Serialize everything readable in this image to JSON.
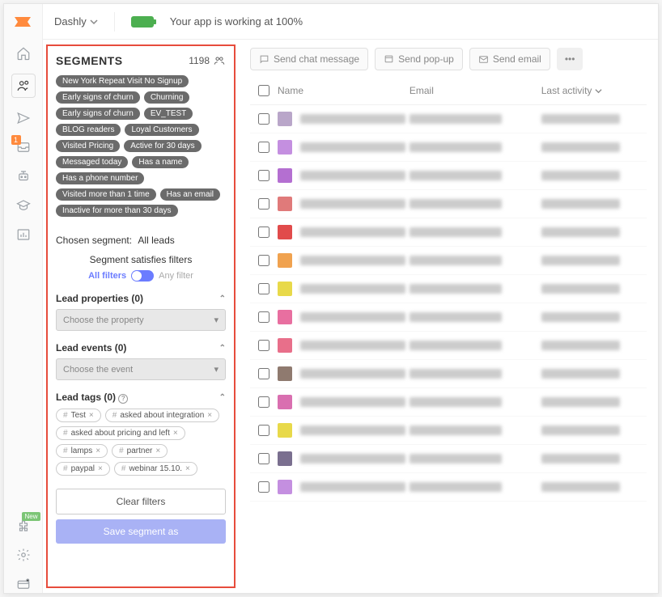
{
  "topbar": {
    "app_dropdown": "Dashly",
    "status_text": "Your app is working at 100%"
  },
  "rail": {
    "inbox_badge": "1",
    "plugin_badge": "New"
  },
  "panel": {
    "title": "SEGMENTS",
    "count": "1198",
    "chips": [
      "New York Repeat Visit No Signup",
      "Early signs of churn",
      "Churning",
      "Early signs of churn",
      "EV_TEST",
      "BLOG readers",
      "Loyal Customers",
      "Visited Pricing",
      "Active for 30 days",
      "Messaged today",
      "Has a name",
      "Has a phone number",
      "Visited more than 1 time",
      "Has an email",
      "Inactive for more than 30 days"
    ],
    "chosen_label": "Chosen segment:",
    "chosen_value": "All leads",
    "satisfies": "Segment satisfies filters",
    "toggle_left": "All filters",
    "toggle_right": "Any filter",
    "props_title": "Lead properties (0)",
    "props_placeholder": "Choose the property",
    "events_title": "Lead events (0)",
    "events_placeholder": "Choose the event",
    "tags_title": "Lead tags (0)",
    "tags": [
      "Test",
      "asked about integration",
      "asked about pricing and left",
      "lamps",
      "partner",
      "paypal",
      "webinar 15.10."
    ],
    "clear_btn": "Clear filters",
    "save_btn": "Save segment as"
  },
  "actions": {
    "chat": "Send chat message",
    "popup": "Send pop-up",
    "email": "Send email"
  },
  "table": {
    "col_name": "Name",
    "col_email": "Email",
    "col_activity": "Last activity",
    "rows": [
      {
        "color": "#b9a6c9"
      },
      {
        "color": "#c48fe0"
      },
      {
        "color": "#b46fd1"
      },
      {
        "color": "#e07a7a"
      },
      {
        "color": "#e14b4b"
      },
      {
        "color": "#f0a24f"
      },
      {
        "color": "#e8d94a"
      },
      {
        "color": "#e86fa0"
      },
      {
        "color": "#e86f8a"
      },
      {
        "color": "#8f7a6f"
      },
      {
        "color": "#d96fb0"
      },
      {
        "color": "#e8d94a"
      },
      {
        "color": "#7a6f8f"
      },
      {
        "color": "#c48fe0"
      }
    ]
  }
}
